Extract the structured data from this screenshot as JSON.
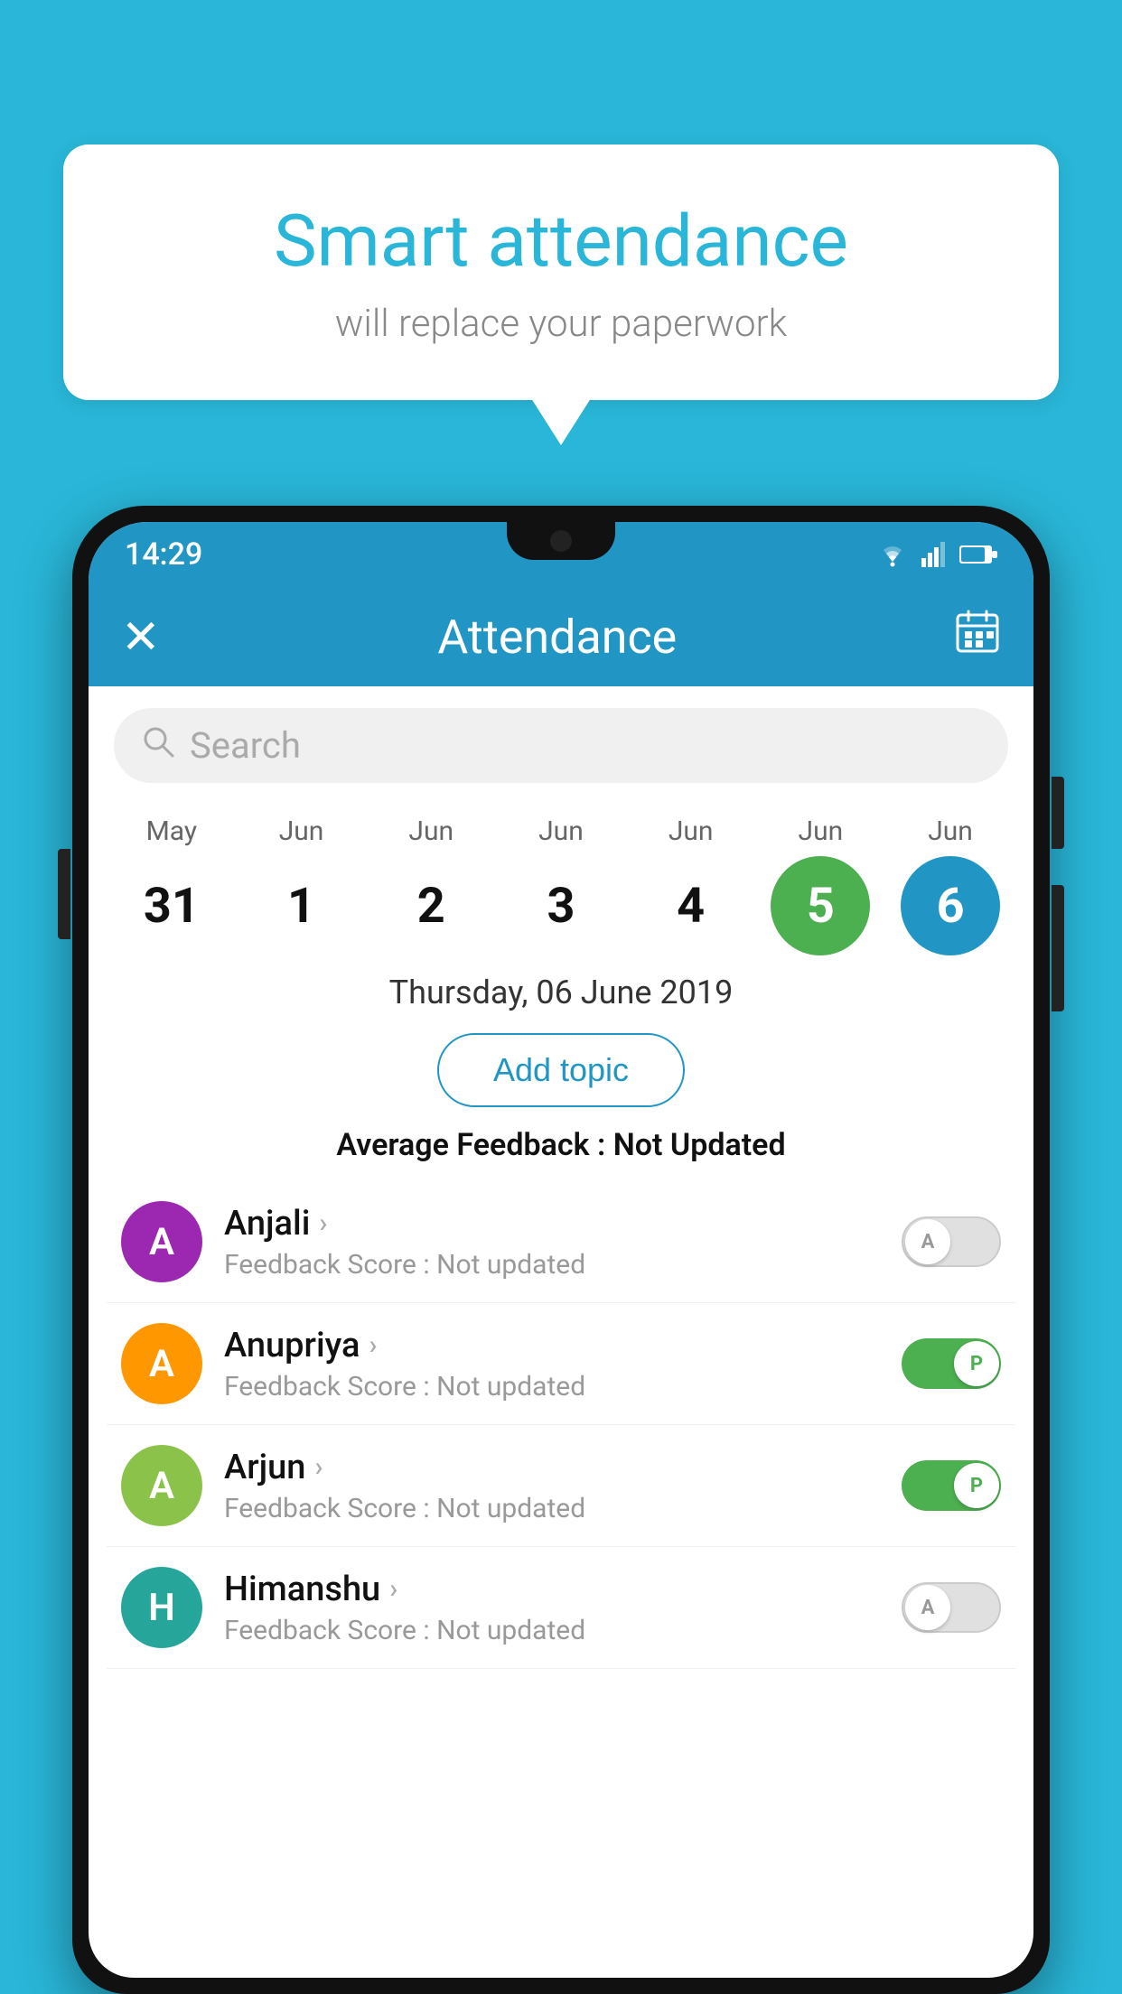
{
  "background_color": "#29b6d8",
  "speech_bubble": {
    "title": "Smart attendance",
    "subtitle": "will replace your paperwork"
  },
  "status_bar": {
    "time": "14:29"
  },
  "app_bar": {
    "title": "Attendance",
    "close_label": "✕",
    "calendar_label": "📅"
  },
  "search": {
    "placeholder": "Search"
  },
  "dates": [
    {
      "month": "May",
      "day": "31",
      "state": "normal"
    },
    {
      "month": "Jun",
      "day": "1",
      "state": "normal"
    },
    {
      "month": "Jun",
      "day": "2",
      "state": "normal"
    },
    {
      "month": "Jun",
      "day": "3",
      "state": "normal"
    },
    {
      "month": "Jun",
      "day": "4",
      "state": "normal"
    },
    {
      "month": "Jun",
      "day": "5",
      "state": "today"
    },
    {
      "month": "Jun",
      "day": "6",
      "state": "selected"
    }
  ],
  "selected_date_label": "Thursday, 06 June 2019",
  "add_topic_label": "Add topic",
  "avg_feedback": {
    "label": "Average Feedback : ",
    "value": "Not Updated"
  },
  "students": [
    {
      "name": "Anjali",
      "avatar_letter": "A",
      "avatar_color": "purple",
      "score_label": "Feedback Score : Not updated",
      "toggle_state": "off",
      "toggle_letter": "A"
    },
    {
      "name": "Anupriya",
      "avatar_letter": "A",
      "avatar_color": "orange",
      "score_label": "Feedback Score : Not updated",
      "toggle_state": "on",
      "toggle_letter": "P"
    },
    {
      "name": "Arjun",
      "avatar_letter": "A",
      "avatar_color": "green",
      "score_label": "Feedback Score : Not updated",
      "toggle_state": "on",
      "toggle_letter": "P"
    },
    {
      "name": "Himanshu",
      "avatar_letter": "H",
      "avatar_color": "teal",
      "score_label": "Feedback Score : Not updated",
      "toggle_state": "off",
      "toggle_letter": "A"
    }
  ]
}
